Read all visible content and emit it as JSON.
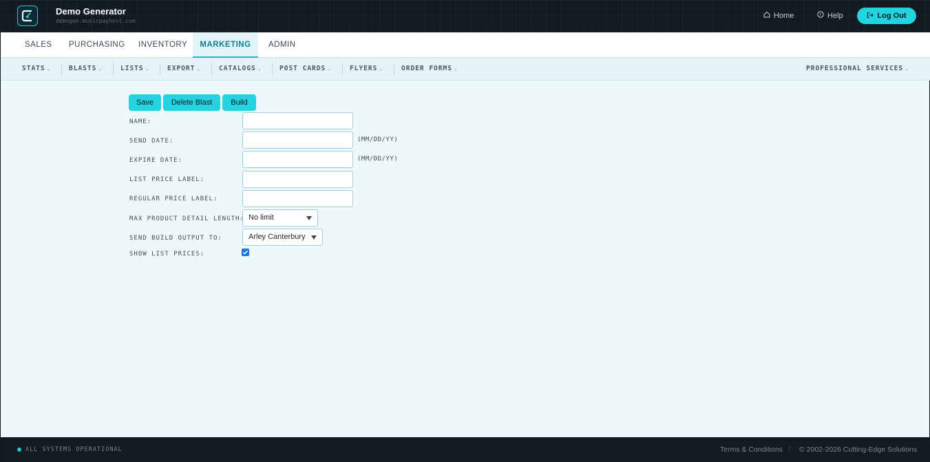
{
  "header": {
    "title": "Demo Generator",
    "subtitle": "demogen.musicpayhost.com",
    "home_label": "Home",
    "help_label": "Help",
    "logout_label": "Log Out"
  },
  "main_tabs": [
    {
      "label": "SALES"
    },
    {
      "label": "PURCHASING"
    },
    {
      "label": "INVENTORY"
    },
    {
      "label": "MARKETING",
      "active": true
    },
    {
      "label": "ADMIN"
    }
  ],
  "sub_nav": {
    "items": [
      {
        "label": "STATS"
      },
      {
        "label": "BLASTS"
      },
      {
        "label": "LISTS"
      },
      {
        "label": "EXPORT"
      },
      {
        "label": "CATALOGS"
      },
      {
        "label": "POST CARDS"
      },
      {
        "label": "FLYERS"
      },
      {
        "label": "ORDER FORMS"
      }
    ],
    "right_item": "PROFESSIONAL SERVICES"
  },
  "toolbar": {
    "save_label": "Save",
    "delete_label": "Delete Blast",
    "build_label": "Build"
  },
  "form": {
    "name_label": "NAME:",
    "name_value": "",
    "send_date_label": "SEND DATE:",
    "send_date_value": "",
    "send_date_hint": "(MM/DD/YY)",
    "expire_date_label": "EXPIRE DATE:",
    "expire_date_value": "",
    "expire_date_hint": "(MM/DD/YY)",
    "list_price_label": "LIST PRICE LABEL:",
    "list_price_value": "",
    "regular_price_label": "REGULAR PRICE LABEL:",
    "regular_price_value": "",
    "max_detail_label": "MAX PRODUCT DETAIL LENGTH:",
    "max_detail_value": "No limit",
    "send_build_label": "SEND BUILD OUTPUT TO:",
    "send_build_value": "Arley Canterbury",
    "show_list_prices_label": "SHOW LIST PRICES:",
    "show_list_prices_checked": true
  },
  "footer": {
    "status": "ALL SYSTEMS OPERATIONAL",
    "terms_label": "Terms & Conditions",
    "separator": "/",
    "copyright": "© 2002-2026 Cutting-Edge Solutions"
  },
  "colors": {
    "accent": "#22d3e0",
    "header_bg": "#121a22",
    "page_bg": "#eef8fb",
    "active_tab_text": "#0d7f93"
  },
  "icons": {
    "logo": "brand-logo-icon",
    "home": "home-icon",
    "help": "help-circle-icon",
    "logout": "logout-icon",
    "chevron": "chevron-down-icon",
    "status": "status-dot-icon"
  }
}
